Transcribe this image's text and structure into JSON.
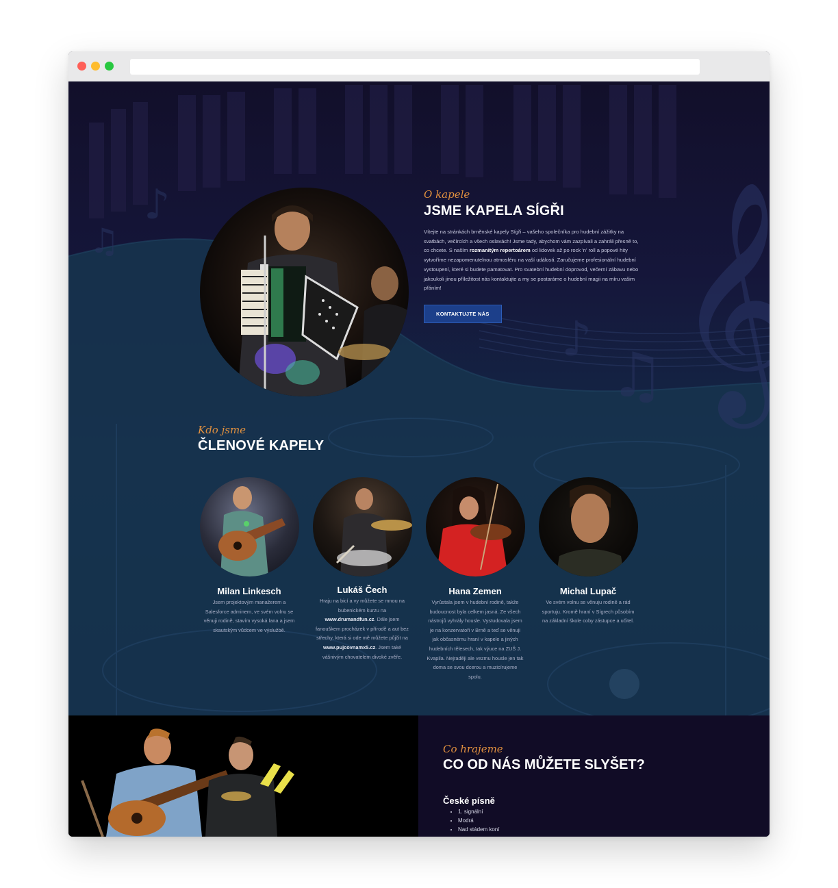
{
  "about": {
    "kicker": "O kapele",
    "title": "JSME KAPELA SÍGŘI",
    "text_1": "Vítejte na stránkách brněnské kapely Sígři – vašeho společníka pro hudební zážitky na svatbách, večírcích a všech oslavách! Jsme tady, abychom vám zazpívali a zahráli přesně to, co chcete. S naším ",
    "text_bold": "rozmanitým repertoárem",
    "text_2": " od lidovek až po rock 'n' roll a popové hity vytvoříme nezapomenutelnou atmosféru na vaší události. Zaručujeme profesionální hudební vystoupení, které si budete pamatovat. Pro svatební hudební doprovod, večerní zábavu nebo jakoukoli jinou příležitost nás kontaktujte a my se postaráme o hudební magii na míru vašim přáním!",
    "cta_label": "KONTAKTUJTE NÁS"
  },
  "members_section": {
    "kicker": "Kdo jsme",
    "title": "ČLENOVÉ KAPELY"
  },
  "members": [
    {
      "name": "Milan Linkesch",
      "bio": "Jsem projektovým manažerem a Salesforce adminem, ve svém volnu se věnuji rodině, stavím vysoká lana a jsem skautským vůdcem ve výslužbě."
    },
    {
      "name": "Lukáš Čech",
      "bio_1": "Hraju na bicí a vy můžete se mnou na bubenickém kurzu na ",
      "link_1": "www.drumandfun.cz",
      "bio_2": ". Dále jsem fanouškem procházek v přírodě a aut bez střechy, která si ode mě můžete půjčit na ",
      "link_2": "www.pujcovnamx5.cz",
      "bio_3": ". Jsem také vášnivým chovatelem divoké zvěře."
    },
    {
      "name": "Hana Zemen",
      "bio": "Vyrůstala jsem v hudební rodině, takže budoucnost byla celkem jasná. Ze všech nástrojů vyhrály housle. Vystudovala jsem je na konzervatoři v Brně a teď se věnuji jak občasnému hraní v kapele a jiných hudebních tělesech, tak výuce na ZUŠ J. Kvapila. Nejraději ale vezmu housle jen tak doma se svou dcerou a muzicírujeme spolu."
    },
    {
      "name": "Michal Lupač",
      "bio": "Ve svém volnu se věnuju rodině a rád sportuju. Kromě hraní v Sígrech působím na základní škole coby zástupce a učitel."
    }
  ],
  "repertoire": {
    "kicker": "Co hrajeme",
    "title": "CO OD NÁS MŮŽETE SLYŠET?",
    "group_title": "České písně",
    "songs": [
      "1. signální",
      "Modrá",
      "Nad stádem koní"
    ]
  },
  "colors": {
    "accent": "#e2913f",
    "button": "#1c3f8a",
    "hero_bg": "#120f2a",
    "section_bg": "#110c26"
  },
  "icons": {
    "window_controls": [
      "close-dot",
      "minimize-dot",
      "maximize-dot"
    ],
    "background": [
      "treble-clef-icon",
      "music-note-icon",
      "piano-keys-decoration"
    ]
  }
}
